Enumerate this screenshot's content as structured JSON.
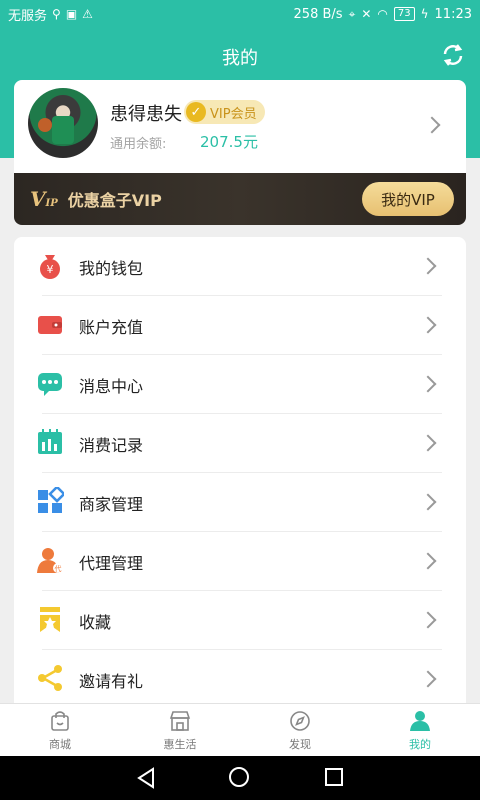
{
  "status_bar": {
    "carrier": "无服务",
    "speed": "258 B/s",
    "battery": "73",
    "time": "11:23"
  },
  "header": {
    "title": "我的"
  },
  "profile": {
    "name": "患得患失",
    "vip_badge": "VIP会员",
    "balance_label": "通用余额:",
    "balance_value": "207.5元"
  },
  "vip_banner": {
    "logo": "V",
    "logo_sub": "IP",
    "title": "优惠盒子VIP",
    "button": "我的VIP"
  },
  "menu": [
    {
      "label": "我的钱包",
      "icon": "money-bag-icon"
    },
    {
      "label": "账户充值",
      "icon": "wallet-icon"
    },
    {
      "label": "消息中心",
      "icon": "chat-icon"
    },
    {
      "label": "消费记录",
      "icon": "chart-icon"
    },
    {
      "label": "商家管理",
      "icon": "grid-icon"
    },
    {
      "label": "代理管理",
      "icon": "agent-icon"
    },
    {
      "label": "收藏",
      "icon": "bookmark-icon"
    },
    {
      "label": "邀请有礼",
      "icon": "share-icon"
    }
  ],
  "tabs": [
    {
      "label": "商城",
      "icon": "shopping-bag-icon"
    },
    {
      "label": "惠生活",
      "icon": "store-icon"
    },
    {
      "label": "发现",
      "icon": "compass-icon"
    },
    {
      "label": "我的",
      "icon": "person-icon"
    }
  ],
  "colors": {
    "brand": "#2bbfa6",
    "vip_gold": "#e7c071"
  }
}
